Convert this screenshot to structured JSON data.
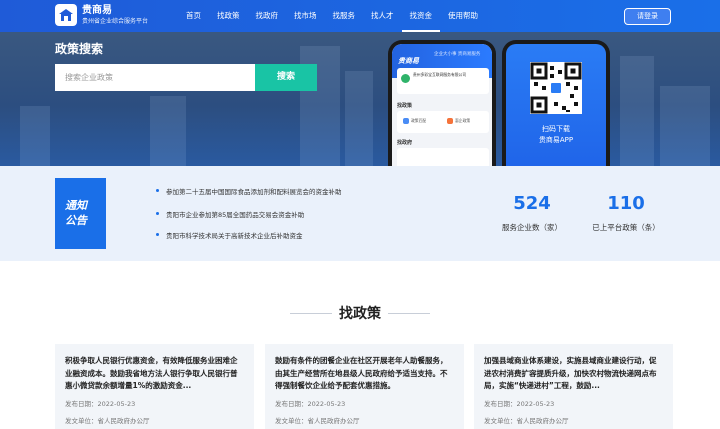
{
  "header": {
    "logo_name": "贵商易",
    "logo_sub": "贵州省企业综合服务平台",
    "nav": [
      {
        "label": "首页",
        "active": false
      },
      {
        "label": "找政策",
        "active": false
      },
      {
        "label": "找政府",
        "active": false
      },
      {
        "label": "找市场",
        "active": false
      },
      {
        "label": "找服务",
        "active": false
      },
      {
        "label": "找人才",
        "active": false
      },
      {
        "label": "找资金",
        "active": true
      },
      {
        "label": "使用帮助",
        "active": false
      }
    ],
    "login_label": "请登录"
  },
  "hero": {
    "title": "政策搜索",
    "search_placeholder": "搜索企业政策",
    "search_button": "搜索",
    "app_brand": "贵商易",
    "app_slogan": "企业大小事  贵商易服务",
    "app_company_line1": "贵州多彩宝互联网服务有限公司",
    "app_company_line2": "",
    "app_section1": "找政策",
    "app_chip1": "政策匹配",
    "app_chip2": "惠企政策",
    "app_section2": "找政府",
    "qr_line1": "扫码下载",
    "qr_line2": "贵商易APP"
  },
  "notice": {
    "label_line1": "通知",
    "label_line2": "公告",
    "items": [
      "参加第二十五届中国国际食品添加剂和配料展览会的资金补助",
      "贵阳市企业参加第85届全国药品交易会资金补助",
      "贵阳市科学技术局关于高新技术企业后补助资金"
    ],
    "stats": [
      {
        "value": "524",
        "label": "服务企业数（家）"
      },
      {
        "value": "110",
        "label": "已上平台政策（条）"
      }
    ]
  },
  "policy": {
    "title": "找政策",
    "cards": [
      {
        "title": "积极争取人民银行优惠资金，有效降低服务业困难企业融资成本。鼓励我省地方法人银行争取人民银行普惠小微贷款余额增量1%的激励资金...",
        "date": "发布日期：2022-05-23",
        "unit": "发文单位：省人民政府办公厅"
      },
      {
        "title": "鼓励有条件的团餐企业在社区开展老年人助餐服务，由其生产经营所在地县级人民政府给予适当支持。不得强制餐饮企业给予配套优惠措施。",
        "date": "发布日期：2022-05-23",
        "unit": "发文单位：省人民政府办公厅"
      },
      {
        "title": "加强县域商业体系建设，实施县域商业建设行动，促进农村消费扩容提质升级，加快农村物流快递网点布局，实施“快递进村”工程，鼓励...",
        "date": "发布日期：2022-05-23",
        "unit": "发文单位：省人民政府办公厅"
      }
    ]
  }
}
